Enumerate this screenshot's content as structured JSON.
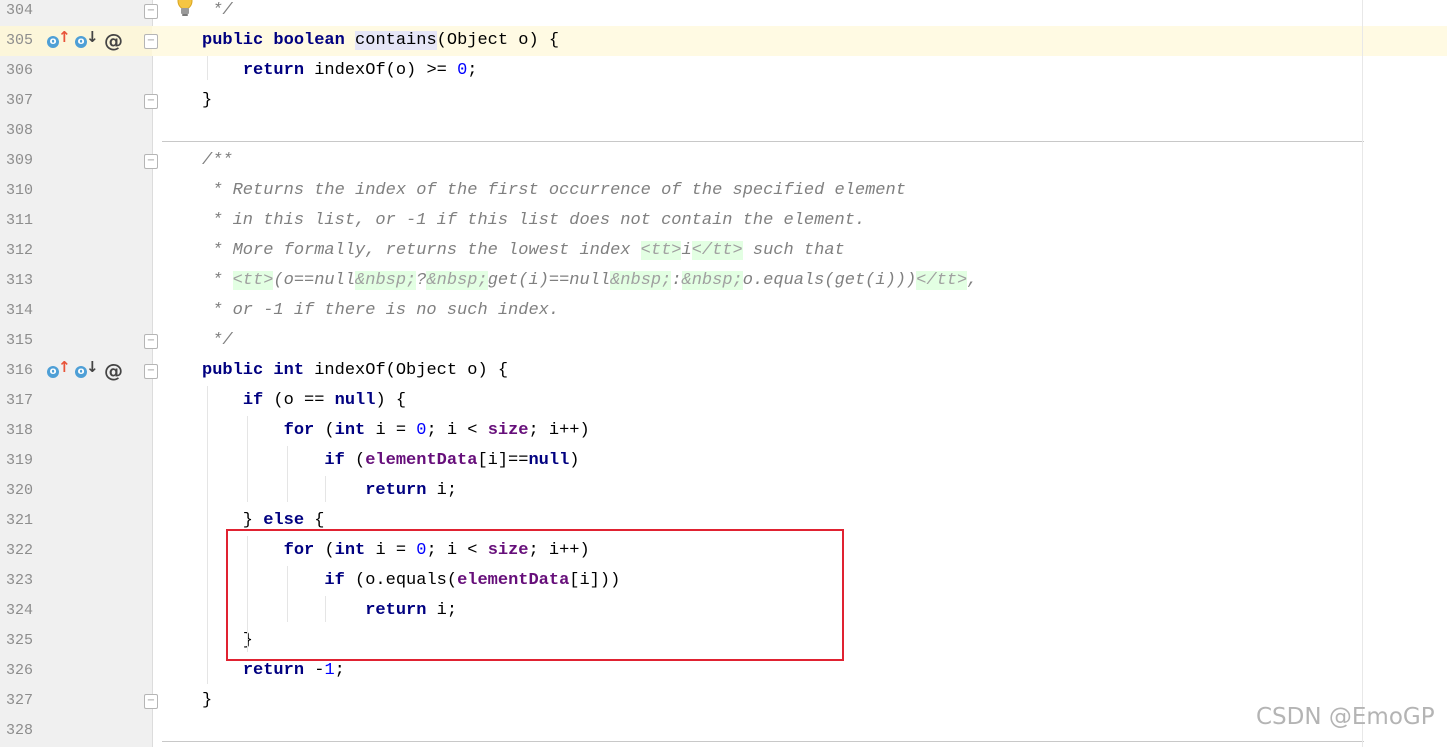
{
  "editor": {
    "current_line": 305,
    "lines": [
      {
        "n": "304",
        "code": [
          {
            "t": " */",
            "c": "cm"
          }
        ]
      },
      {
        "n": "305",
        "code": [
          {
            "t": "public ",
            "c": "kw"
          },
          {
            "t": "boolean ",
            "c": "kw"
          },
          {
            "t": "contains",
            "c": "usage"
          },
          {
            "t": "(Object o) {"
          }
        ]
      },
      {
        "n": "306",
        "code": [
          {
            "t": "    "
          },
          {
            "t": "return ",
            "c": "kw"
          },
          {
            "t": "indexOf(o) >= "
          },
          {
            "t": "0",
            "c": "num"
          },
          {
            "t": ";"
          }
        ]
      },
      {
        "n": "307",
        "code": [
          {
            "t": "}"
          }
        ]
      },
      {
        "n": "308",
        "code": []
      },
      {
        "n": "309",
        "code": [
          {
            "t": "/**",
            "c": "cm"
          }
        ]
      },
      {
        "n": "310",
        "code": [
          {
            "t": " * Returns the index of the first occurrence of the specified element",
            "c": "cm"
          }
        ]
      },
      {
        "n": "311",
        "code": [
          {
            "t": " * in this list, or -1 if this list does not contain the element.",
            "c": "cm"
          }
        ]
      },
      {
        "n": "312",
        "code": [
          {
            "t": " * More formally, returns the lowest index ",
            "c": "cm"
          },
          {
            "t": "<tt>",
            "c": "cm tag"
          },
          {
            "t": "i",
            "c": "cm"
          },
          {
            "t": "</tt>",
            "c": "cm tag"
          },
          {
            "t": " such that",
            "c": "cm"
          }
        ]
      },
      {
        "n": "313",
        "code": [
          {
            "t": " * ",
            "c": "cm"
          },
          {
            "t": "<tt>",
            "c": "cm tag"
          },
          {
            "t": "(o==null",
            "c": "cm"
          },
          {
            "t": "&nbsp;",
            "c": "cm tag"
          },
          {
            "t": "?",
            "c": "cm"
          },
          {
            "t": "&nbsp;",
            "c": "cm tag"
          },
          {
            "t": "get(i)==null",
            "c": "cm"
          },
          {
            "t": "&nbsp;",
            "c": "cm tag"
          },
          {
            "t": ":",
            "c": "cm"
          },
          {
            "t": "&nbsp;",
            "c": "cm tag"
          },
          {
            "t": "o.equals(get(i)))",
            "c": "cm"
          },
          {
            "t": "</tt>",
            "c": "cm tag"
          },
          {
            "t": ",",
            "c": "cm"
          }
        ]
      },
      {
        "n": "314",
        "code": [
          {
            "t": " * or -1 if there is no such index.",
            "c": "cm"
          }
        ]
      },
      {
        "n": "315",
        "code": [
          {
            "t": " */",
            "c": "cm"
          }
        ]
      },
      {
        "n": "316",
        "code": [
          {
            "t": "public ",
            "c": "kw"
          },
          {
            "t": "int ",
            "c": "kw"
          },
          {
            "t": "indexOf(Object o) {"
          }
        ]
      },
      {
        "n": "317",
        "code": [
          {
            "t": "    "
          },
          {
            "t": "if ",
            "c": "kw"
          },
          {
            "t": "(o == "
          },
          {
            "t": "null",
            "c": "kw"
          },
          {
            "t": ") {"
          }
        ]
      },
      {
        "n": "318",
        "code": [
          {
            "t": "        "
          },
          {
            "t": "for ",
            "c": "kw"
          },
          {
            "t": "("
          },
          {
            "t": "int ",
            "c": "kw"
          },
          {
            "t": "i = "
          },
          {
            "t": "0",
            "c": "num"
          },
          {
            "t": "; i < "
          },
          {
            "t": "size",
            "c": "fld"
          },
          {
            "t": "; i++)"
          }
        ]
      },
      {
        "n": "319",
        "code": [
          {
            "t": "            "
          },
          {
            "t": "if ",
            "c": "kw"
          },
          {
            "t": "("
          },
          {
            "t": "elementData",
            "c": "fld"
          },
          {
            "t": "[i]=="
          },
          {
            "t": "null",
            "c": "kw"
          },
          {
            "t": ")"
          }
        ]
      },
      {
        "n": "320",
        "code": [
          {
            "t": "                "
          },
          {
            "t": "return ",
            "c": "kw"
          },
          {
            "t": "i;"
          }
        ]
      },
      {
        "n": "321",
        "code": [
          {
            "t": "    } "
          },
          {
            "t": "else ",
            "c": "kw"
          },
          {
            "t": "{"
          }
        ]
      },
      {
        "n": "322",
        "code": [
          {
            "t": "        "
          },
          {
            "t": "for ",
            "c": "kw"
          },
          {
            "t": "("
          },
          {
            "t": "int ",
            "c": "kw"
          },
          {
            "t": "i = "
          },
          {
            "t": "0",
            "c": "num"
          },
          {
            "t": "; i < "
          },
          {
            "t": "size",
            "c": "fld"
          },
          {
            "t": "; i++)"
          }
        ]
      },
      {
        "n": "323",
        "code": [
          {
            "t": "            "
          },
          {
            "t": "if ",
            "c": "kw"
          },
          {
            "t": "(o.equals("
          },
          {
            "t": "elementData",
            "c": "fld"
          },
          {
            "t": "[i]))"
          }
        ]
      },
      {
        "n": "324",
        "code": [
          {
            "t": "                "
          },
          {
            "t": "return ",
            "c": "kw"
          },
          {
            "t": "i;"
          }
        ]
      },
      {
        "n": "325",
        "code": [
          {
            "t": "    }"
          }
        ]
      },
      {
        "n": "326",
        "code": [
          {
            "t": "    "
          },
          {
            "t": "return ",
            "c": "kw"
          },
          {
            "t": "-"
          },
          {
            "t": "1",
            "c": "num"
          },
          {
            "t": ";"
          }
        ]
      },
      {
        "n": "327",
        "code": [
          {
            "t": "}"
          }
        ]
      },
      {
        "n": "328",
        "code": []
      }
    ],
    "override_lines": [
      "305",
      "316"
    ],
    "fold_lines": [
      "304",
      "305",
      "307",
      "309",
      "315",
      "316",
      "327"
    ],
    "icons": {
      "bulb": "lightbulb-icon",
      "implemented": "implemented-up-icon",
      "overridden": "overridden-down-icon",
      "annotation": "at-icon",
      "fold": "fold-toggle-icon"
    },
    "override_badge": "o",
    "override_up_arrow": "↑",
    "override_down_arrow": "↓",
    "annotation_symbol": "@",
    "highlight_color": "#e02231"
  },
  "watermark": "CSDN @EmoGP"
}
